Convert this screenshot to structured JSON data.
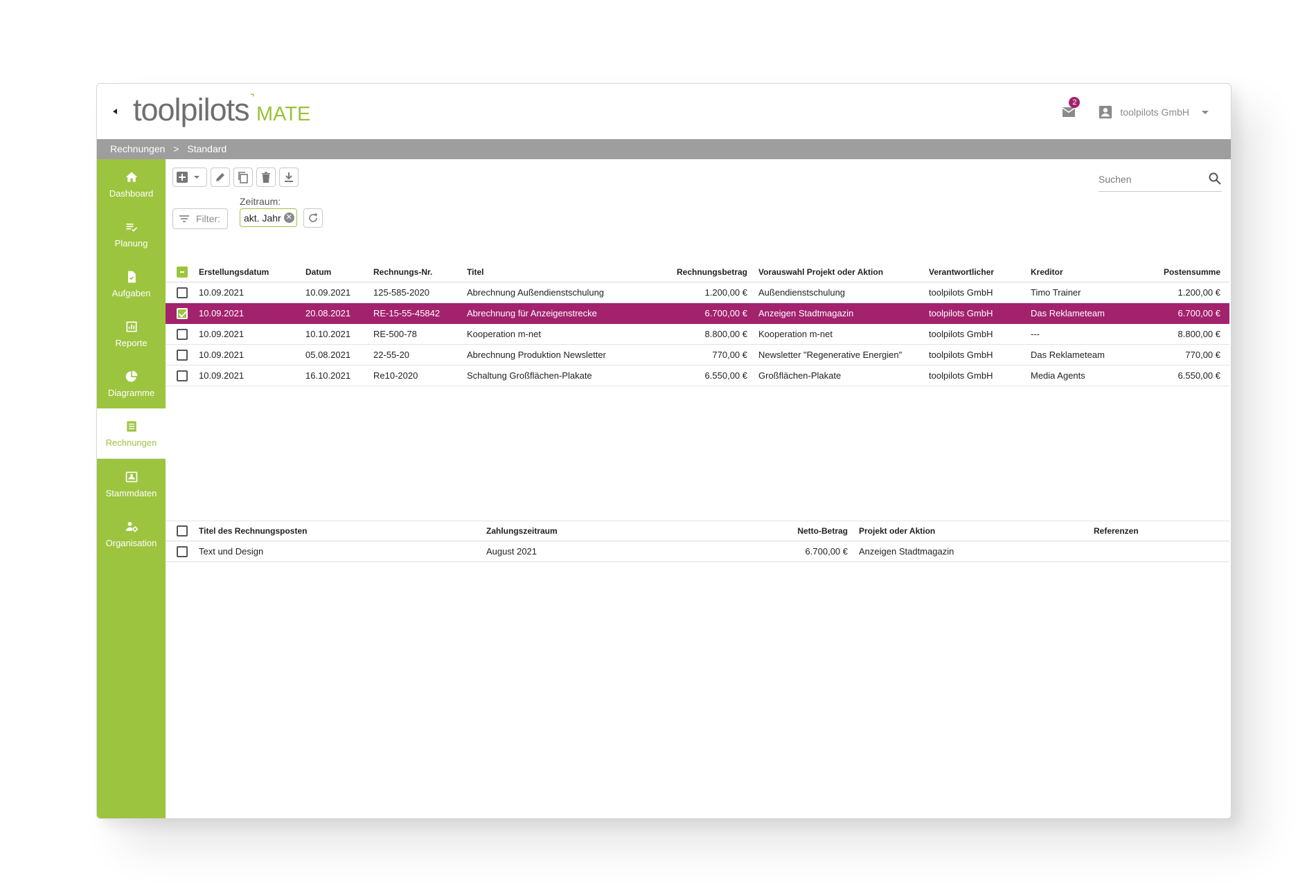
{
  "header": {
    "logo_primary": "toolpilots",
    "logo_mark": "˺",
    "logo_secondary": "MATE",
    "mail_badge": "2",
    "user_name": "toolpilots GmbH"
  },
  "breadcrumb": {
    "items": [
      "Rechnungen",
      ">",
      "Standard"
    ]
  },
  "sidebar": {
    "items": [
      {
        "label": "Dashboard",
        "icon": "home-icon"
      },
      {
        "label": "Planung",
        "icon": "list-check-icon"
      },
      {
        "label": "Aufgaben",
        "icon": "task-document-icon"
      },
      {
        "label": "Reporte",
        "icon": "report-chart-icon"
      },
      {
        "label": "Diagramme",
        "icon": "pie-chart-icon"
      },
      {
        "label": "Rechnungen",
        "icon": "invoice-list-icon",
        "active": true
      },
      {
        "label": "Stammdaten",
        "icon": "master-data-icon"
      },
      {
        "label": "Organisation",
        "icon": "organisation-icon"
      }
    ]
  },
  "search": {
    "placeholder": "Suchen"
  },
  "filter": {
    "label": "Filter:",
    "zeitraum_label": "Zeitraum:",
    "zeitraum_value": "akt. Jahr"
  },
  "colors": {
    "accent_green": "#9dc43f",
    "selected_row": "#a3226d",
    "breadcrumb_bar": "#9e9e9e"
  },
  "invoices": {
    "columns": [
      "Erstellungsdatum",
      "Datum",
      "Rechnungs-Nr.",
      "Titel",
      "Rechnungsbetrag",
      "Vorauswahl Projekt oder Aktion",
      "Verantwortlicher",
      "Kreditor",
      "Postensumme"
    ],
    "rows": [
      [
        "10.09.2021",
        "10.09.2021",
        "125-585-2020",
        "Abrechnung Außendienstschulung",
        "1.200,00 €",
        "Außendienstschulung",
        "toolpilots GmbH",
        "Timo Trainer",
        "1.200,00 €"
      ],
      [
        "10.09.2021",
        "20.08.2021",
        "RE-15-55-45842",
        "Abrechnung für Anzeigenstrecke",
        "6.700,00 €",
        "Anzeigen Stadtmagazin",
        "toolpilots GmbH",
        "Das Reklameteam",
        "6.700,00 €"
      ],
      [
        "10.09.2021",
        "10.10.2021",
        "RE-500-78",
        "Kooperation m-net",
        "8.800,00 €",
        "Kooperation m-net",
        "toolpilots GmbH",
        "---",
        "8.800,00 €"
      ],
      [
        "10.09.2021",
        "05.08.2021",
        "22-55-20",
        "Abrechnung Produktion Newsletter",
        "770,00 €",
        "Newsletter \"Regenerative Energien\"",
        "toolpilots GmbH",
        "Das Reklameteam",
        "770,00 €"
      ],
      [
        "10.09.2021",
        "16.10.2021",
        "Re10-2020",
        "Schaltung Großflächen-Plakate",
        "6.550,00 €",
        "Großflächen-Plakate",
        "toolpilots GmbH",
        "Media Agents",
        "6.550,00 €"
      ]
    ]
  },
  "items": {
    "columns": [
      "Titel des Rechnungsposten",
      "Zahlungszeitraum",
      "Netto-Betrag",
      "Projekt oder Aktion",
      "Referenzen"
    ],
    "rows": [
      [
        "Text und Design",
        "August 2021",
        "6.700,00 €",
        "Anzeigen Stadtmagazin",
        ""
      ]
    ]
  }
}
